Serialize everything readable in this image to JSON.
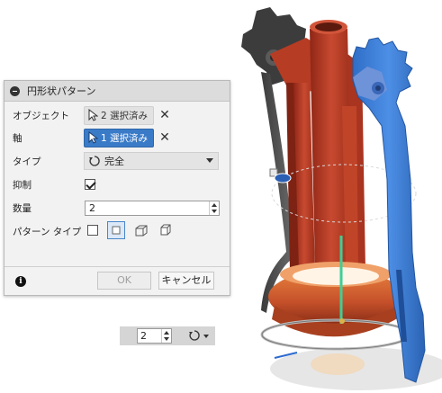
{
  "dialog": {
    "title": "円形状パターン",
    "rows": {
      "objects": {
        "label": "オブジェクト",
        "value": "2 選択済み"
      },
      "axis": {
        "label": "軸",
        "value": "1 選択済み"
      },
      "type": {
        "label": "タイプ",
        "value": "完全"
      },
      "suppress": {
        "label": "抑制",
        "checked": true
      },
      "quantity": {
        "label": "数量",
        "value": "2"
      },
      "pattern_type": {
        "label": "パターン タイプ"
      }
    },
    "ok_label": "OK",
    "cancel_label": "キャンセル"
  },
  "mini_toolbar": {
    "quantity": "2"
  },
  "colors": {
    "selection_blue": "#3a7bc8",
    "part_red": "#c0432a",
    "part_blue": "#3b7fd6",
    "part_dark": "#4a4a4a",
    "base_orange": "#d56a3a"
  },
  "icons": [
    "collapse-icon",
    "cursor-icon",
    "clear-icon",
    "rotate-full-icon",
    "info-icon"
  ]
}
